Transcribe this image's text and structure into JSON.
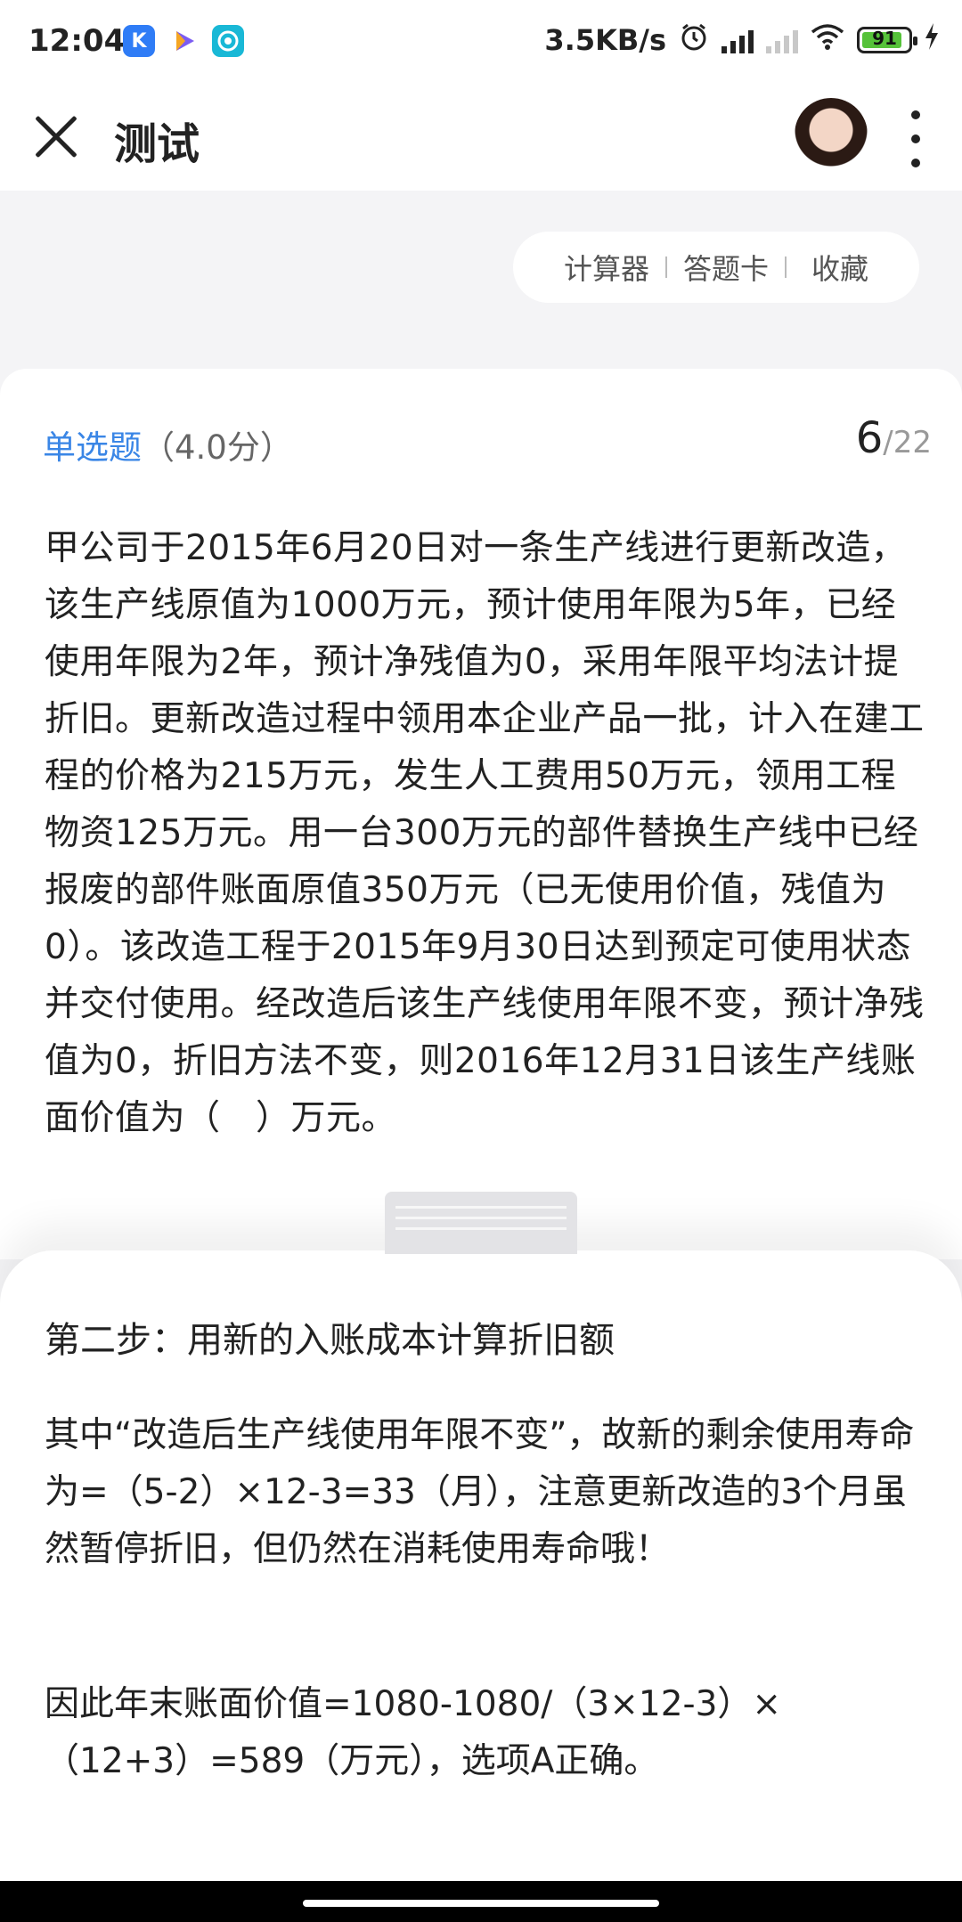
{
  "status_bar": {
    "time": "12:04",
    "net_speed": "3.5KB/s",
    "battery": "91",
    "app_icons": [
      "k-app-icon",
      "video-app-icon",
      "circle-app-icon"
    ]
  },
  "header": {
    "title": "测试"
  },
  "tools": {
    "calculator": "计算器",
    "answer_card": "答题卡",
    "favorite": "收藏"
  },
  "question": {
    "type": "单选题",
    "score": "（4.0分）",
    "current": "6",
    "total": "/22",
    "text": "甲公司于2015年6月20日对一条生产线进行更新改造，该生产线原值为1000万元，预计使用年限为5年，已经使用年限为2年，预计净残值为0，采用年限平均法计提折旧。更新改造过程中领用本企业产品一批，计入在建工程的价格为215万元，发生人工费用50万元，领用工程物资125万元。用一台300万元的部件替换生产线中已经报废的部件账面原值350万元（已无使用价值，残值为0）。该改造工程于2015年9月30日达到预定可使用状态并交付使用。经改造后该生产线使用年限不变，预计净残值为0，折旧方法不变，则2016年12月31日该生产线账面价值为（　）万元。"
  },
  "analysis": {
    "step_title": "第二步：用新的入账成本计算折旧额",
    "para1": "其中“改造后生产线使用年限不变”，故新的剩余使用寿命为=（5-2）×12-3=33（月），注意更新改造的3个月虽然暂停折旧，但仍然在消耗使用寿命哦！",
    "para2": "因此年末账面价值=1080-1080/（3×12-3）×（12+3）=589（万元），选项A正确。"
  },
  "colors": {
    "accent": "#3a86e6",
    "page_bg": "#f4f4f6",
    "battery_fill": "#56c23a"
  }
}
